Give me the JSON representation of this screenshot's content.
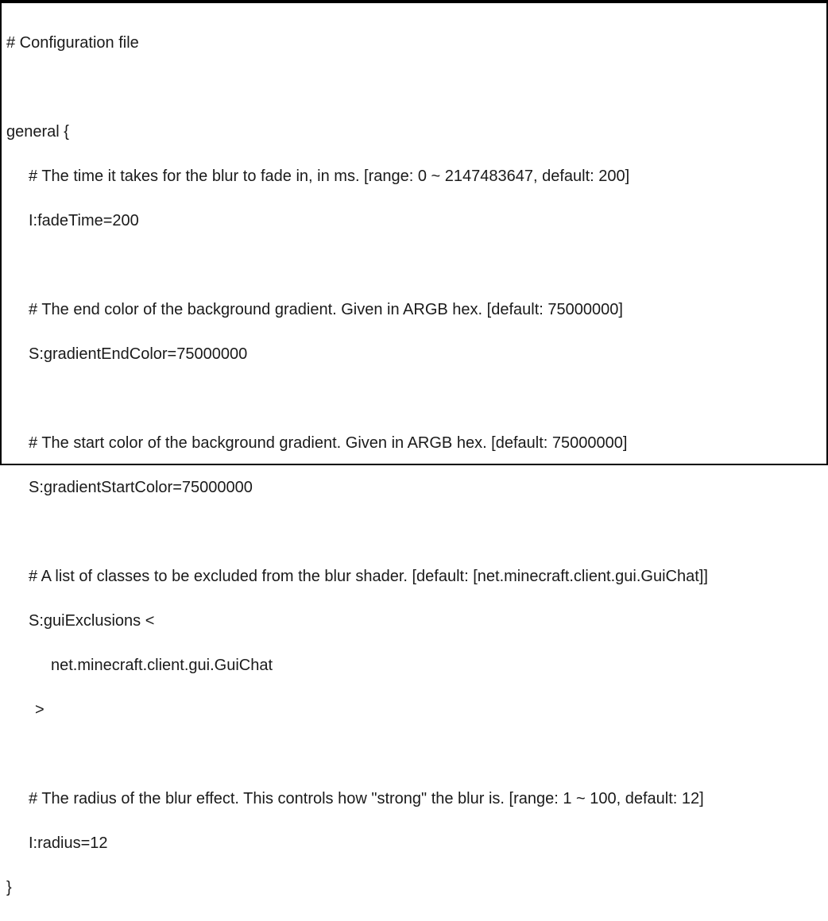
{
  "config": {
    "header_comment": "# Configuration file",
    "blank": "",
    "section_open": "general {",
    "fade": {
      "comment": "# The time it takes for the blur to fade in, in ms. [range: 0 ~ 2147483647, default: 200]",
      "assignment": "I:fadeTime=200"
    },
    "grad_end": {
      "comment": "# The end color of the background gradient. Given in ARGB hex. [default: 75000000]",
      "assignment": "S:gradientEndColor=75000000"
    },
    "grad_start": {
      "comment": "# The start color of the background gradient. Given in ARGB hex. [default: 75000000]",
      "assignment": "S:gradientStartColor=75000000"
    },
    "exclusions": {
      "comment": "# A list of classes to be excluded from the blur shader. [default: [net.minecraft.client.gui.GuiChat]]",
      "open": "S:guiExclusions <",
      "item": "net.minecraft.client.gui.GuiChat",
      "close": ">"
    },
    "radius": {
      "comment": "# The radius of the blur effect. This controls how \"strong\" the blur is. [range: 1 ~ 100, default: 12]",
      "assignment": "I:radius=12"
    },
    "section_close": "}"
  }
}
